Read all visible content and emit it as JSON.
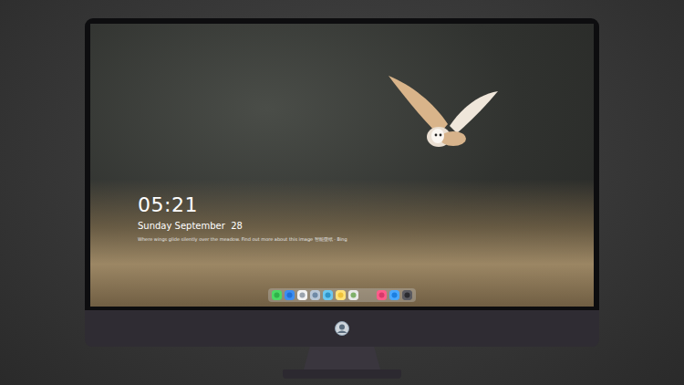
{
  "lock_screen": {
    "time": "05:21",
    "date": "Sunday September  28",
    "caption": "Where wings glide silently over the meadow. Find out more about this image  智能壁纸 · Bing"
  }
}
